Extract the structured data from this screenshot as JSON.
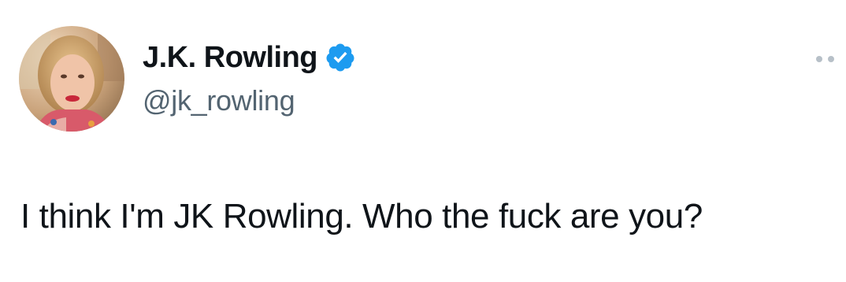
{
  "author": {
    "display_name": "J.K. Rowling",
    "handle": "@jk_rowling",
    "verified": true,
    "avatar_icon": "profile-photo"
  },
  "tweet": {
    "text": "I think I'm JK Rowling. Who the fuck are you?"
  },
  "more_icon": "more-options-icon",
  "colors": {
    "text_primary": "#0f1419",
    "text_secondary": "#536471",
    "verified_blue": "#1d9bf0",
    "more_dots": "#b7c0c8",
    "background": "#ffffff"
  }
}
